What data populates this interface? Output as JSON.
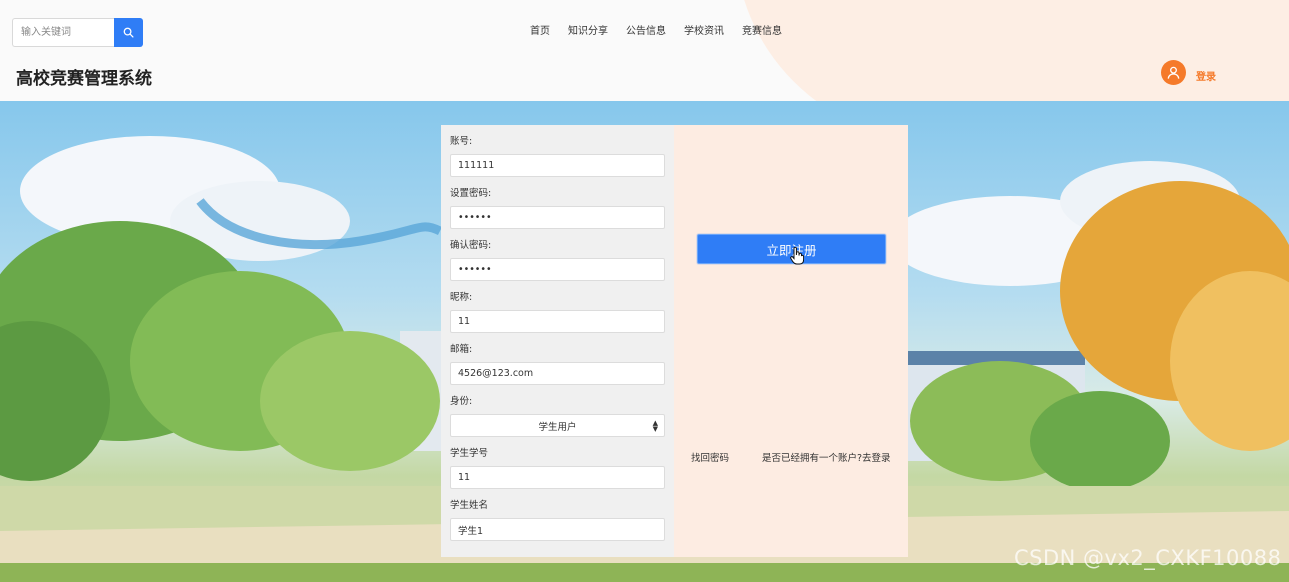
{
  "header": {
    "search_placeholder": "输入关键词",
    "nav": [
      "首页",
      "知识分享",
      "公告信息",
      "学校资讯",
      "竞赛信息"
    ],
    "site_title": "高校竞赛管理系统",
    "login_label": "登录"
  },
  "form": {
    "account_label": "账号:",
    "account_value": "111111",
    "password_label": "设置密码:",
    "password_value": "111111",
    "confirm_label": "确认密码:",
    "confirm_value": "111111",
    "nickname_label": "昵称:",
    "nickname_value": "11",
    "email_label": "邮箱:",
    "email_value": "4526@123.com",
    "identity_label": "身份:",
    "identity_value": "学生用户",
    "student_no_label": "学生学号",
    "student_no_value": "11",
    "student_name_label": "学生姓名",
    "student_name_value": "学生1"
  },
  "actions": {
    "register_label": "立即注册",
    "forgot_label": "找回密码",
    "has_account_label": "是否已经拥有一个账户?去登录"
  },
  "watermark": "CSDN @vx2_CXKF10088",
  "colors": {
    "primary": "#2f7df6",
    "accent": "#f57a2a",
    "panel_bg": "#f0f0f0",
    "right_panel_bg": "#fdece2"
  }
}
